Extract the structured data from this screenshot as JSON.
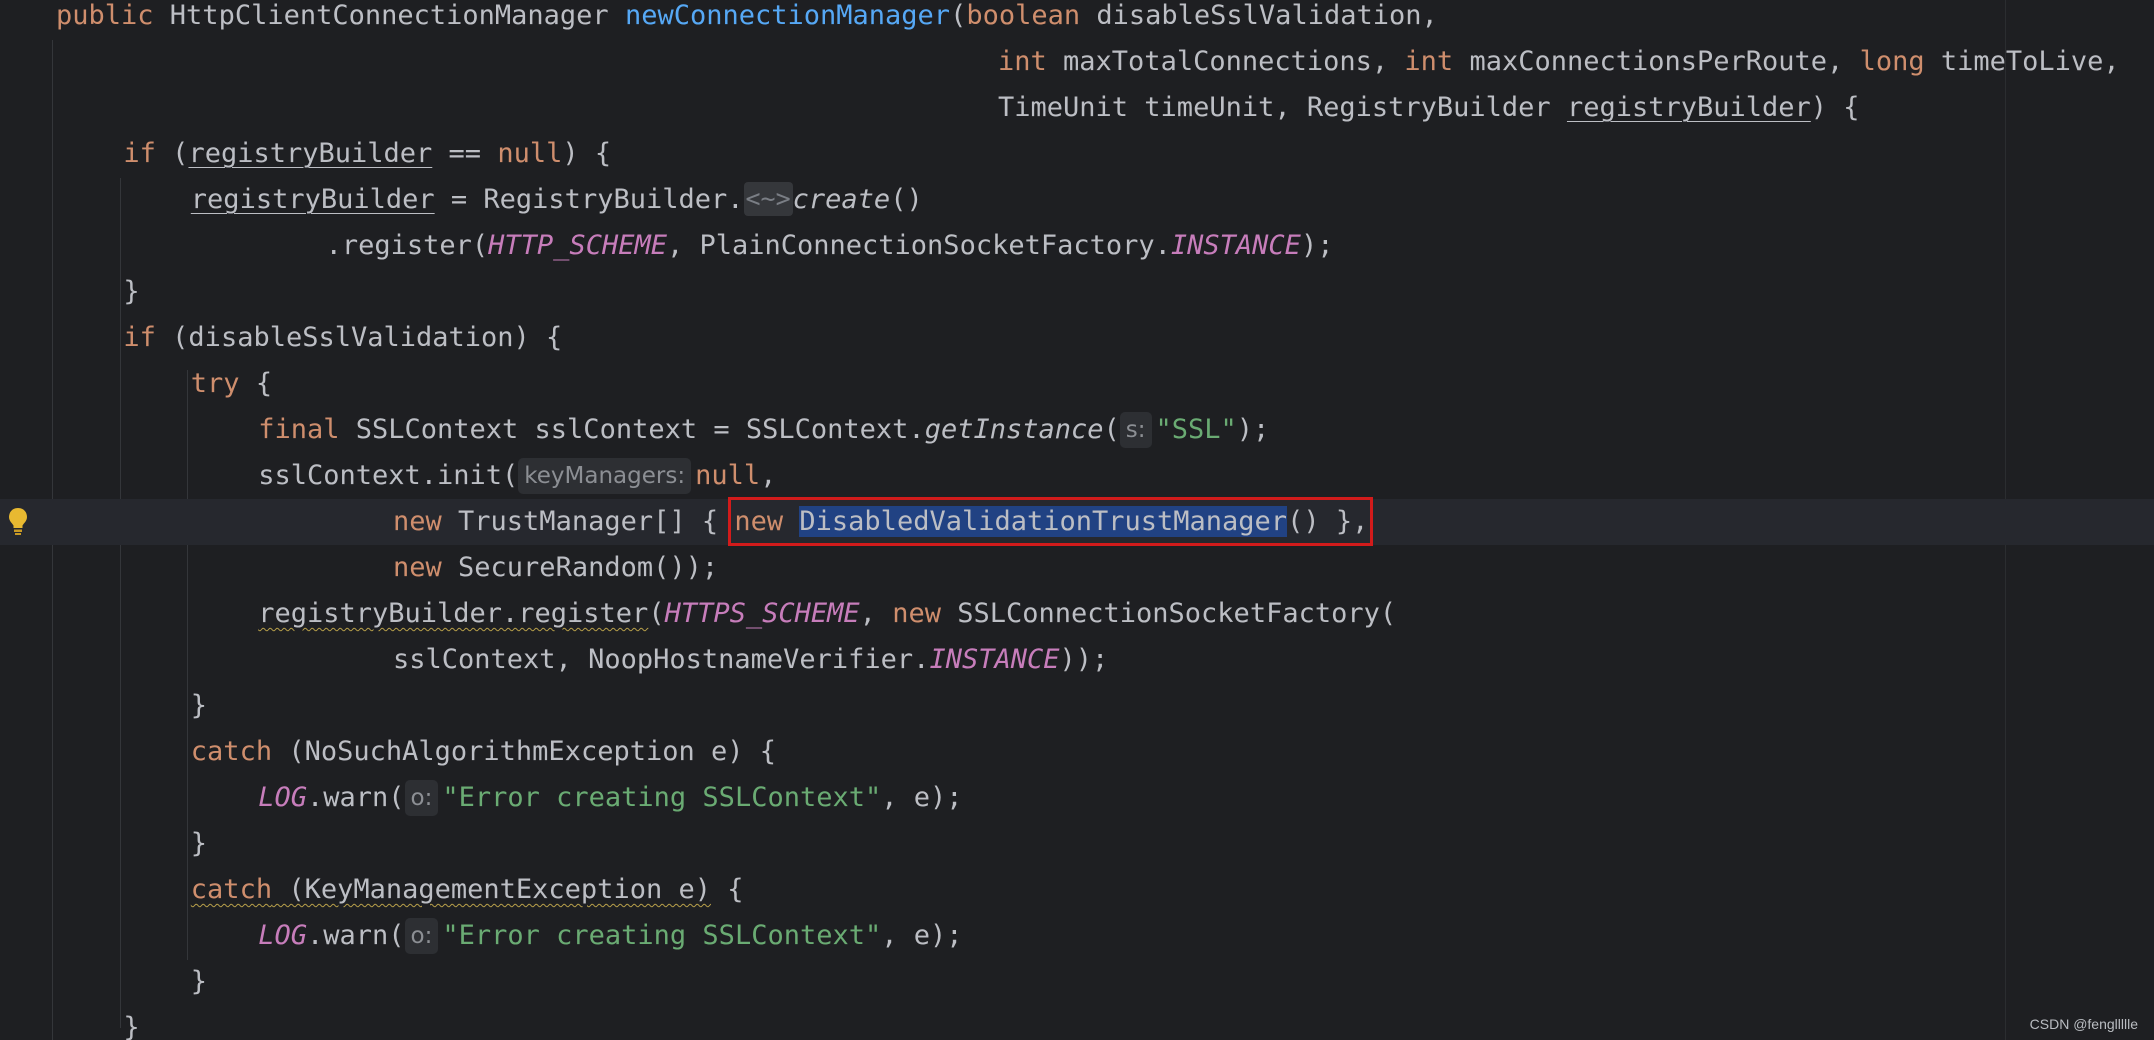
{
  "editor": {
    "lines": [
      {
        "indent": 0,
        "parts": [
          {
            "t": "public ",
            "c": "kw"
          },
          {
            "t": "HttpClientConnectionManager "
          },
          {
            "t": "newConnectionManager",
            "c": "fn"
          },
          {
            "t": "("
          },
          {
            "t": "boolean ",
            "c": "kw"
          },
          {
            "t": "disableSslValidation,"
          }
        ]
      },
      {
        "indent": 0,
        "pad": 1000,
        "parts": [
          {
            "t": "int ",
            "c": "kw"
          },
          {
            "t": "maxTotalConnections, "
          },
          {
            "t": "int ",
            "c": "kw"
          },
          {
            "t": "maxConnectionsPerRoute, "
          },
          {
            "t": "long ",
            "c": "kw"
          },
          {
            "t": "timeToLive,"
          }
        ]
      },
      {
        "indent": 0,
        "pad": 1000,
        "parts": [
          {
            "t": "TimeUnit timeUnit, RegistryBuilder "
          },
          {
            "t": "registryBuilder",
            "c": "ul"
          },
          {
            "t": ") {"
          }
        ]
      },
      {
        "indent": 2,
        "parts": [
          {
            "t": "if ",
            "c": "kw"
          },
          {
            "t": "("
          },
          {
            "t": "registryBuilder",
            "c": "ul"
          },
          {
            "t": " == "
          },
          {
            "t": "null",
            "c": "kw"
          },
          {
            "t": ") {"
          }
        ]
      },
      {
        "indent": 4,
        "parts": [
          {
            "t": "registryBuilder",
            "c": "ul"
          },
          {
            "t": " = RegistryBuilder."
          },
          {
            "t": "<~>",
            "c": "diamond"
          },
          {
            "t": "create",
            "c": "ital"
          },
          {
            "t": "()"
          }
        ]
      },
      {
        "indent": 8,
        "parts": [
          {
            "t": ".register("
          },
          {
            "t": "HTTP_SCHEME",
            "c": "konst"
          },
          {
            "t": ", PlainConnectionSocketFactory."
          },
          {
            "t": "INSTANCE",
            "c": "konst"
          },
          {
            "t": ");"
          }
        ]
      },
      {
        "indent": 2,
        "parts": [
          {
            "t": "}"
          }
        ]
      },
      {
        "indent": 2,
        "parts": [
          {
            "t": "if ",
            "c": "kw"
          },
          {
            "t": "(disableSslValidation) {"
          }
        ]
      },
      {
        "indent": 4,
        "parts": [
          {
            "t": "try ",
            "c": "kw"
          },
          {
            "t": "{"
          }
        ]
      },
      {
        "indent": 6,
        "parts": [
          {
            "t": "final ",
            "c": "kw"
          },
          {
            "t": "SSLContext sslContext = SSLContext."
          },
          {
            "t": "getInstance",
            "c": "ital"
          },
          {
            "t": "("
          },
          {
            "t": "s:",
            "c": "hint"
          },
          {
            "t": "\"SSL\"",
            "c": "str"
          },
          {
            "t": ");"
          }
        ]
      },
      {
        "indent": 6,
        "parts": [
          {
            "t": "sslContext.init("
          },
          {
            "t": "keyManagers:",
            "c": "hint"
          },
          {
            "t": "null",
            "c": "kw"
          },
          {
            "t": ","
          }
        ]
      },
      {
        "indent": 10,
        "current": true,
        "parts": [
          {
            "t": "new ",
            "c": "kw"
          },
          {
            "t": "TrustManager[] { "
          },
          {
            "t": "new ",
            "c": "kw"
          },
          {
            "t": "DisabledValidationTrustManager",
            "c": "sel"
          },
          {
            "t": "() },"
          }
        ]
      },
      {
        "indent": 10,
        "parts": [
          {
            "t": "new ",
            "c": "kw"
          },
          {
            "t": "SecureRandom());"
          }
        ]
      },
      {
        "indent": 6,
        "parts": [
          {
            "t": "registryBuilder.register",
            "c": "warn"
          },
          {
            "t": "("
          },
          {
            "t": "HTTPS_SCHEME",
            "c": "konst"
          },
          {
            "t": ", "
          },
          {
            "t": "new ",
            "c": "kw"
          },
          {
            "t": "SSLConnectionSocketFactory("
          }
        ]
      },
      {
        "indent": 10,
        "parts": [
          {
            "t": "sslContext, NoopHostnameVerifier."
          },
          {
            "t": "INSTANCE",
            "c": "konst"
          },
          {
            "t": "));"
          }
        ]
      },
      {
        "indent": 4,
        "parts": [
          {
            "t": "}"
          }
        ]
      },
      {
        "indent": 4,
        "parts": [
          {
            "t": "catch ",
            "c": "kw"
          },
          {
            "t": "(NoSuchAlgorithmException e) {"
          }
        ]
      },
      {
        "indent": 6,
        "parts": [
          {
            "t": "LOG",
            "c": "konst"
          },
          {
            "t": ".warn("
          },
          {
            "t": "o:",
            "c": "hint"
          },
          {
            "t": "\"Error creating SSLContext\"",
            "c": "str"
          },
          {
            "t": ", e);"
          }
        ]
      },
      {
        "indent": 4,
        "parts": [
          {
            "t": "}"
          }
        ]
      },
      {
        "indent": 4,
        "parts": [
          {
            "t": "catch (KeyManagementException e)",
            "c": "warn kwfirst"
          },
          {
            "t": " {"
          }
        ]
      },
      {
        "indent": 6,
        "parts": [
          {
            "t": "LOG",
            "c": "konst"
          },
          {
            "t": ".warn("
          },
          {
            "t": "o:",
            "c": "hint"
          },
          {
            "t": "\"Error creating SSLContext\"",
            "c": "str"
          },
          {
            "t": ", e);"
          }
        ]
      },
      {
        "indent": 4,
        "parts": [
          {
            "t": "}"
          }
        ]
      },
      {
        "indent": 2,
        "parts": [
          {
            "t": "}"
          }
        ]
      }
    ]
  },
  "watermark": "CSDN @fengllllle",
  "colors": {
    "background": "#1e1f22",
    "keyword": "#cf8e6d",
    "method": "#56a8f5",
    "string": "#6aab73",
    "constant": "#c77dbb",
    "highlight_box": "#d21b1b",
    "selection": "#214283"
  },
  "icons": {
    "gutter": "lightbulb-icon"
  }
}
